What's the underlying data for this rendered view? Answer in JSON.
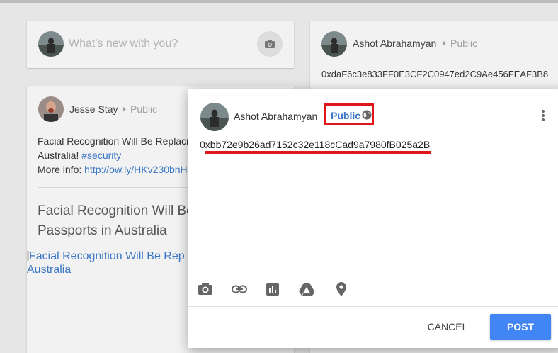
{
  "composer": {
    "placeholder": "What's new with you?",
    "camera_icon": "camera-icon"
  },
  "posts": [
    {
      "author": "Jesse Stay",
      "audience": "Public",
      "text_line1": "Facial Recognition Will Be Replacin",
      "text_line2_prefix": "Australia! ",
      "hashtag": "#security",
      "text_line3_prefix": "More info: ",
      "link": "http://ow.ly/HKv230bnH",
      "heading_line1": "Facial Recognition Will Be",
      "heading_line2": "Passports in Australia",
      "image_alt_line1": "Facial Recognition Will Be Rep",
      "image_alt_line2": "Australia"
    },
    {
      "author": "Ashot Abrahamyan",
      "audience": "Public",
      "text": "0xdaF6c3e833FF0E3CF2C0947ed2C9Ae456FEAF3B8"
    }
  ],
  "dialog": {
    "author": "Ashot Abrahamyan",
    "audience": "Public",
    "audience_icon": "globe-icon",
    "menu_icon": "more-vert-icon",
    "input_text": "0xbb72e9b26ad7152c32e118cCad9a7980fB025a2B",
    "toolbar": [
      "camera-icon",
      "link-icon",
      "poll-icon",
      "drive-icon",
      "location-icon"
    ],
    "cancel_label": "CANCEL",
    "post_label": "POST"
  },
  "colors": {
    "accent": "#4285f4",
    "link": "#3b76c4",
    "annotation_red": "#e0161d"
  }
}
